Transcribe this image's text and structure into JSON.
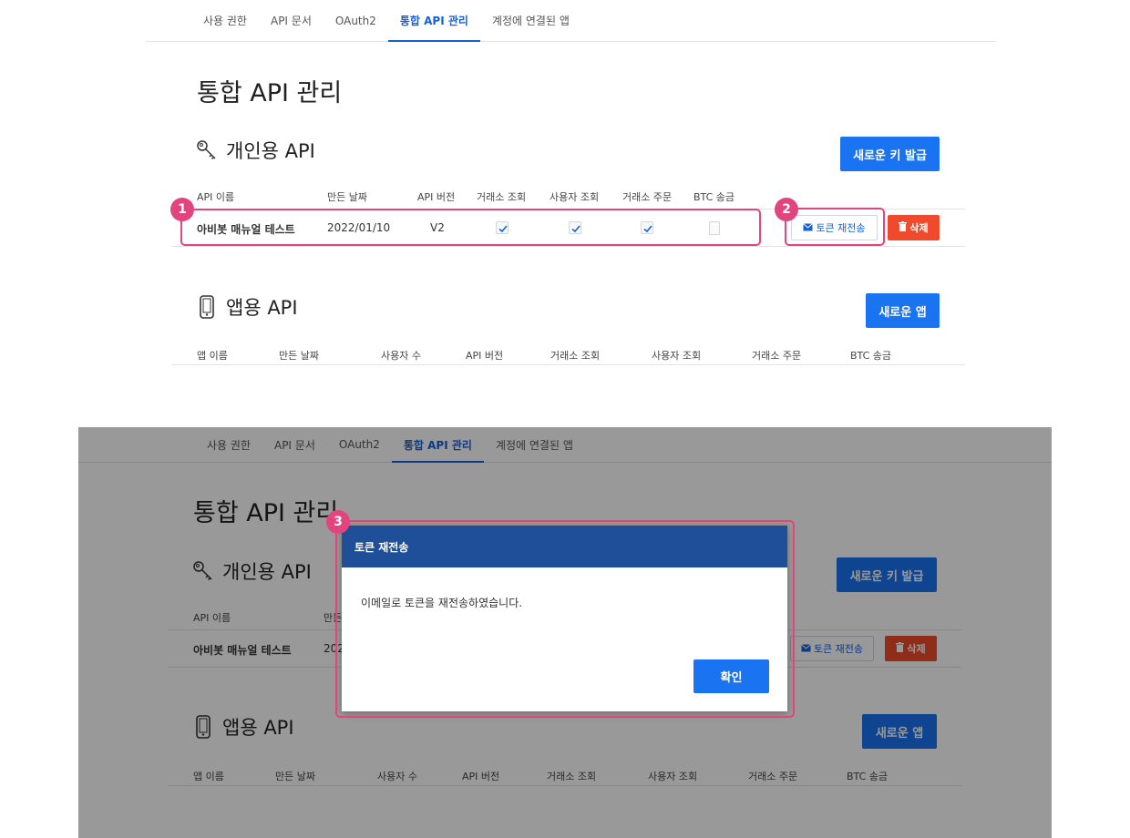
{
  "tabs": [
    "사용 권한",
    "API 문서",
    "OAuth2",
    "통합 API 관리",
    "계정에 연결된 앱"
  ],
  "active_tab_index": 3,
  "page_title": "통합 API 관리",
  "personal": {
    "title": "개인용 API",
    "icon": "key-icon",
    "new_key_button": "새로운 키 발급",
    "columns": [
      "API 이름",
      "만든 날짜",
      "API 버전",
      "거래소 조회",
      "사용자 조회",
      "거래소 주문",
      "BTC 송금"
    ],
    "row": {
      "name": "아비봇 매뉴얼 테스트",
      "date": "2022/01/10",
      "version": "V2",
      "exchange_read": true,
      "user_read": true,
      "exchange_order": true,
      "btc_send": false
    },
    "resend_button": "토큰 재전송",
    "delete_button": "삭제"
  },
  "app": {
    "title": "앱용 API",
    "icon": "phone-icon",
    "new_app_button": "새로운 앱",
    "columns": [
      "앱 이름",
      "만든 날짜",
      "사용자 수",
      "API 버전",
      "거래소 조회",
      "사용자 조회",
      "거래소 주문",
      "BTC 송금"
    ]
  },
  "bottom_personal_row_date": "202",
  "bottom_personal_col_date": "만든",
  "modal": {
    "title": "토큰 재전송",
    "message": "이메일로 토큰을 재전송하였습니다.",
    "ok_button": "확인"
  },
  "markers": [
    "1",
    "2",
    "3"
  ],
  "colors": {
    "primary": "#1a73f0",
    "active_tab": "#1a5fd6",
    "danger": "#f04a2c",
    "highlight": "#e2457d",
    "modal_header": "#1e4f98"
  }
}
